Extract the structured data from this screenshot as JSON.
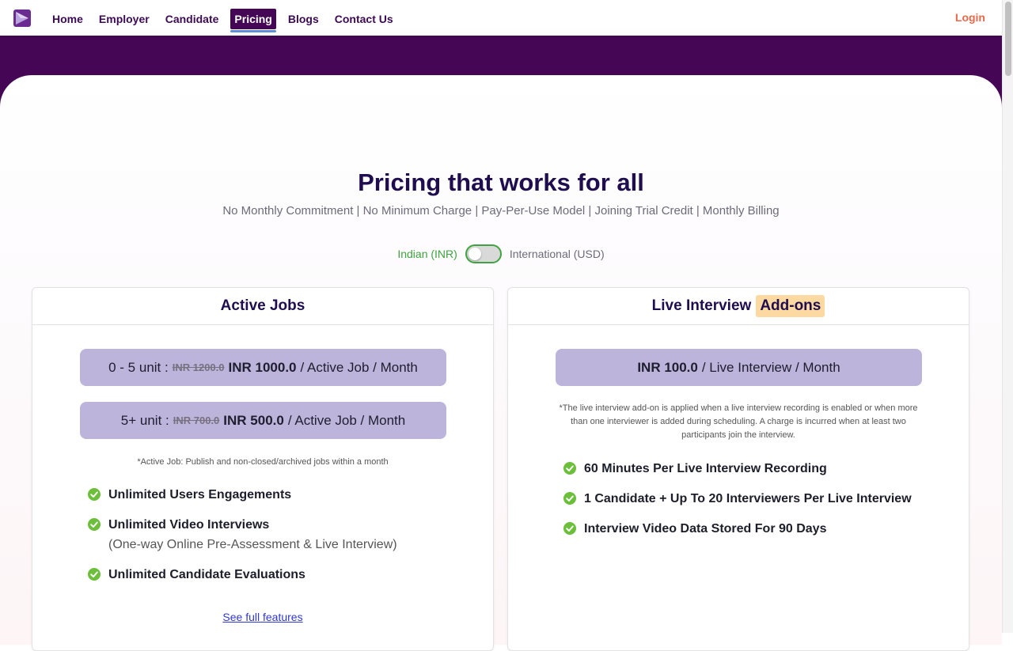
{
  "colors": {
    "brand_purple": "#450755",
    "accent_orange": "#e8694a",
    "pill_lavender": "#bdb4dc",
    "check_green": "#6bbf3a",
    "addon_highlight": "#fbd9a0"
  },
  "nav": {
    "logo_icon": "play-triangle-logo-icon",
    "links": [
      "Home",
      "Employer",
      "Candidate",
      "Pricing",
      "Blogs",
      "Contact Us"
    ],
    "active": "Pricing",
    "login": "Login"
  },
  "hero": {
    "title": "Pricing that works for all",
    "subtitle": "No Monthly Commitment | No Minimum Charge | Pay-Per-Use Model | Joining Trial Credit | Monthly Billing"
  },
  "currency": {
    "inr_label": "Indian (INR)",
    "usd_label": "International (USD)",
    "selected": "Indian (INR)"
  },
  "active_jobs": {
    "title": "Active Jobs",
    "tiers": [
      {
        "range": "0 - 5 unit :",
        "old_price": "INR 1200.0",
        "price": "INR 1000.0",
        "unit": "/ Active Job / Month"
      },
      {
        "range": "5+ unit :",
        "old_price": "INR 700.0",
        "price": "INR 500.0",
        "unit": "/ Active Job / Month"
      }
    ],
    "footnote": "*Active Job: Publish and non-closed/archived jobs within a month",
    "features": [
      {
        "title": "Unlimited Users Engagements",
        "sub": ""
      },
      {
        "title": "Unlimited Video Interviews",
        "sub": "(One-way Online Pre-Assessment & Live Interview)"
      },
      {
        "title": "Unlimited Candidate Evaluations",
        "sub": ""
      }
    ],
    "link": "See full features"
  },
  "live_interview": {
    "title": "Live Interview",
    "badge": "Add-ons",
    "price": "INR 100.0",
    "unit": "/ Live Interview / Month",
    "footnote_lines": [
      "*The live interview add-on is applied when a live interview recording is enabled or when more",
      "than one interviewer is added during scheduling. A charge is incurred when at least two",
      "participants join the interview."
    ],
    "features": [
      "60 Minutes Per Live Interview Recording",
      "1 Candidate + Up To 20 Interviewers Per Live Interview",
      "Interview Video Data Stored For 90 Days"
    ]
  }
}
